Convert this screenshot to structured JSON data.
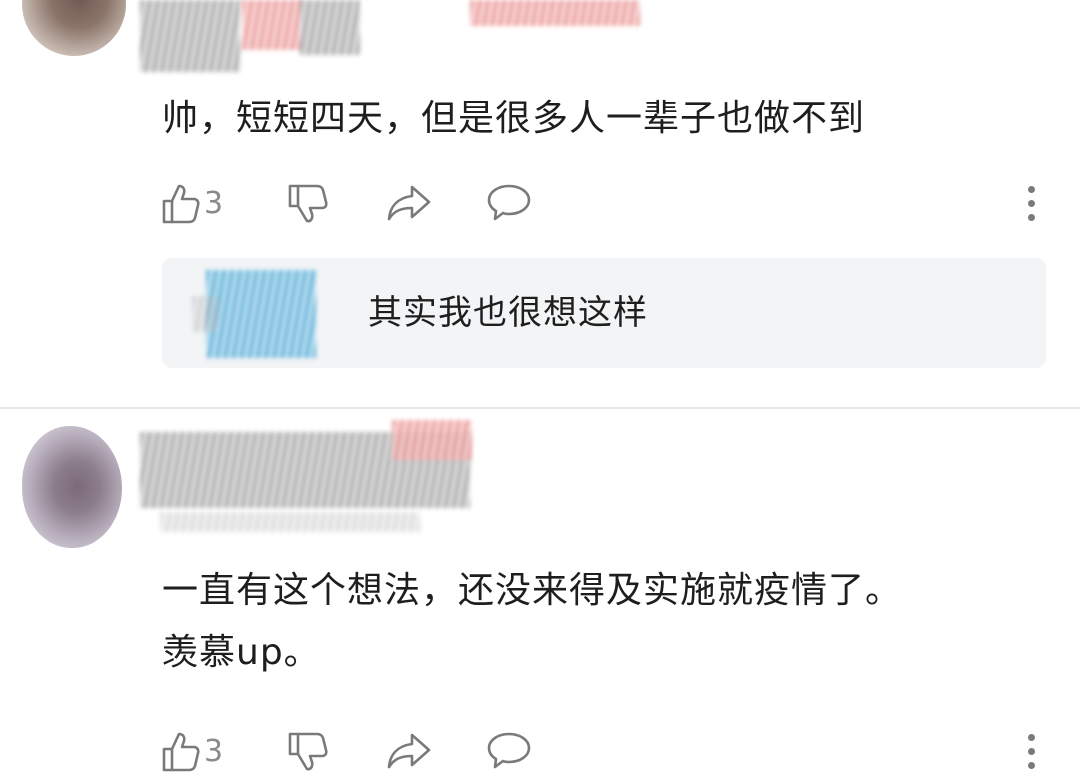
{
  "comments": [
    {
      "text_lines": [
        "帅，短短四天，但是很多人一辈子也做不到"
      ],
      "like_count": "3",
      "reply_preview": {
        "text": "其实我也很想这样"
      },
      "icons": [
        "thumbs-up-icon",
        "thumbs-down-icon",
        "share-arrow-icon",
        "speech-bubble-icon",
        "more-vertical-icon"
      ]
    },
    {
      "text_lines": [
        "一直有这个想法，还没来得及实施就疫情了。",
        "羡慕up。"
      ],
      "like_count": "3",
      "icons": [
        "thumbs-up-icon",
        "thumbs-down-icon",
        "share-arrow-icon",
        "speech-bubble-icon",
        "more-vertical-icon"
      ]
    }
  ],
  "colors": {
    "text": "#1e1e1e",
    "icon": "#7a7a7a",
    "reply_background": "#f2f4f6",
    "divider": "#e6e6e6"
  }
}
